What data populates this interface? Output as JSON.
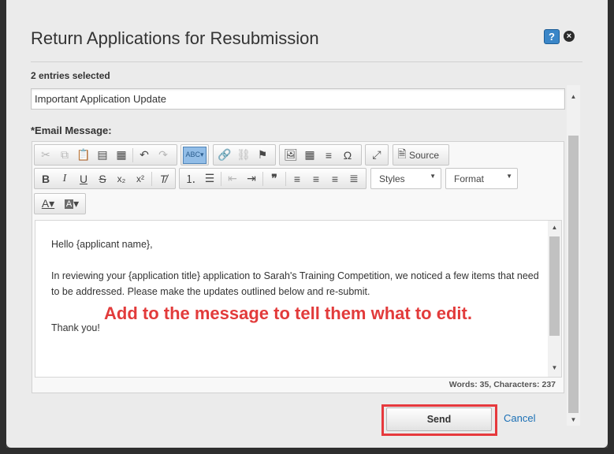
{
  "dialog": {
    "title": "Return Applications for Resubmission",
    "help_label": "?",
    "close_label": "×"
  },
  "entries_selected": "2 entries selected",
  "subject": {
    "value": "Important Application Update"
  },
  "email_label": "*Email Message:",
  "toolbar": {
    "source_label": "Source",
    "styles_label": "Styles",
    "format_label": "Format"
  },
  "message": {
    "greeting": "Hello {applicant name},",
    "body": "In reviewing your {application title} application to Sarah's Training Competition, we noticed a few items that need to be addressed. Please make the updates outlined below and re-submit.",
    "closing": "Thank you!"
  },
  "annotation": "Add to the message to tell them what to edit.",
  "status": "Words: 35, Characters: 237",
  "buttons": {
    "send": "Send",
    "cancel": "Cancel"
  },
  "colors": {
    "annotation": "#e23b3b",
    "highlight_border": "#e6393d",
    "link": "#1a6fb5",
    "help_button": "#3a86c8"
  },
  "icons": [
    "cut-icon",
    "copy-icon",
    "paste-icon",
    "paste-text-icon",
    "paste-word-icon",
    "undo-icon",
    "redo-icon",
    "spellcheck-icon",
    "link-icon",
    "unlink-icon",
    "anchor-icon",
    "image-icon",
    "table-icon",
    "horizontal-line-icon",
    "special-char-icon",
    "maximize-icon",
    "source-icon",
    "bold-icon",
    "italic-icon",
    "underline-icon",
    "strikethrough-icon",
    "subscript-icon",
    "superscript-icon",
    "remove-format-icon",
    "numbered-list-icon",
    "bulleted-list-icon",
    "outdent-icon",
    "indent-icon",
    "blockquote-icon",
    "align-left-icon",
    "align-center-icon",
    "align-right-icon",
    "justify-icon",
    "text-color-icon",
    "background-color-icon"
  ]
}
